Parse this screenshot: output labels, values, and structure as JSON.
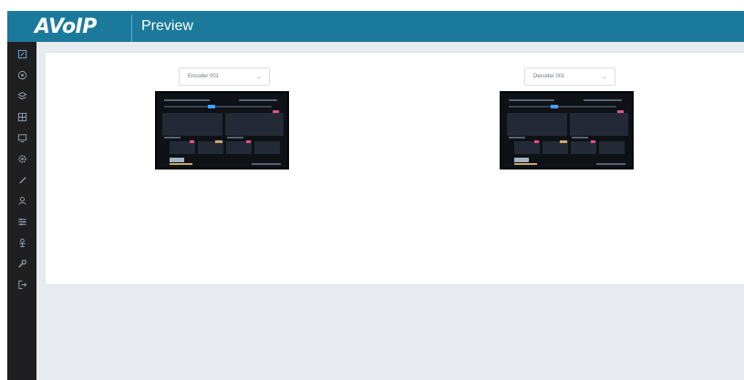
{
  "header": {
    "logo": "AVoIP",
    "title": "Preview"
  },
  "sidebar": {
    "items": [
      {
        "name": "edit-icon",
        "glyph": "✎",
        "active": true
      },
      {
        "name": "dashboard-icon",
        "glyph": "◉",
        "active": false
      },
      {
        "name": "layers-icon",
        "glyph": "◈",
        "active": false
      },
      {
        "name": "display-icon",
        "glyph": "▣",
        "active": false
      },
      {
        "name": "monitor-icon",
        "glyph": "▭",
        "active": false
      },
      {
        "name": "settings-icon",
        "glyph": "⚙",
        "active": false
      },
      {
        "name": "tool-icon",
        "glyph": "✐",
        "active": false
      },
      {
        "name": "user-icon",
        "glyph": "♙",
        "active": false
      },
      {
        "name": "sliders-icon",
        "glyph": "☰",
        "active": false
      },
      {
        "name": "users-icon",
        "glyph": "♟",
        "active": false
      },
      {
        "name": "wrench-icon",
        "glyph": "⚒",
        "active": false
      },
      {
        "name": "logout-icon",
        "glyph": "⇥",
        "active": false
      }
    ]
  },
  "previews": [
    {
      "select_value": "Encoder 001"
    },
    {
      "select_value": "Decoder 001"
    }
  ],
  "colors": {
    "header": "#1b7a9c",
    "sidebar": "#1f1f22",
    "content_bg": "#e7eaee",
    "accent": "#3ba1ff",
    "badge": "#e6508a"
  }
}
